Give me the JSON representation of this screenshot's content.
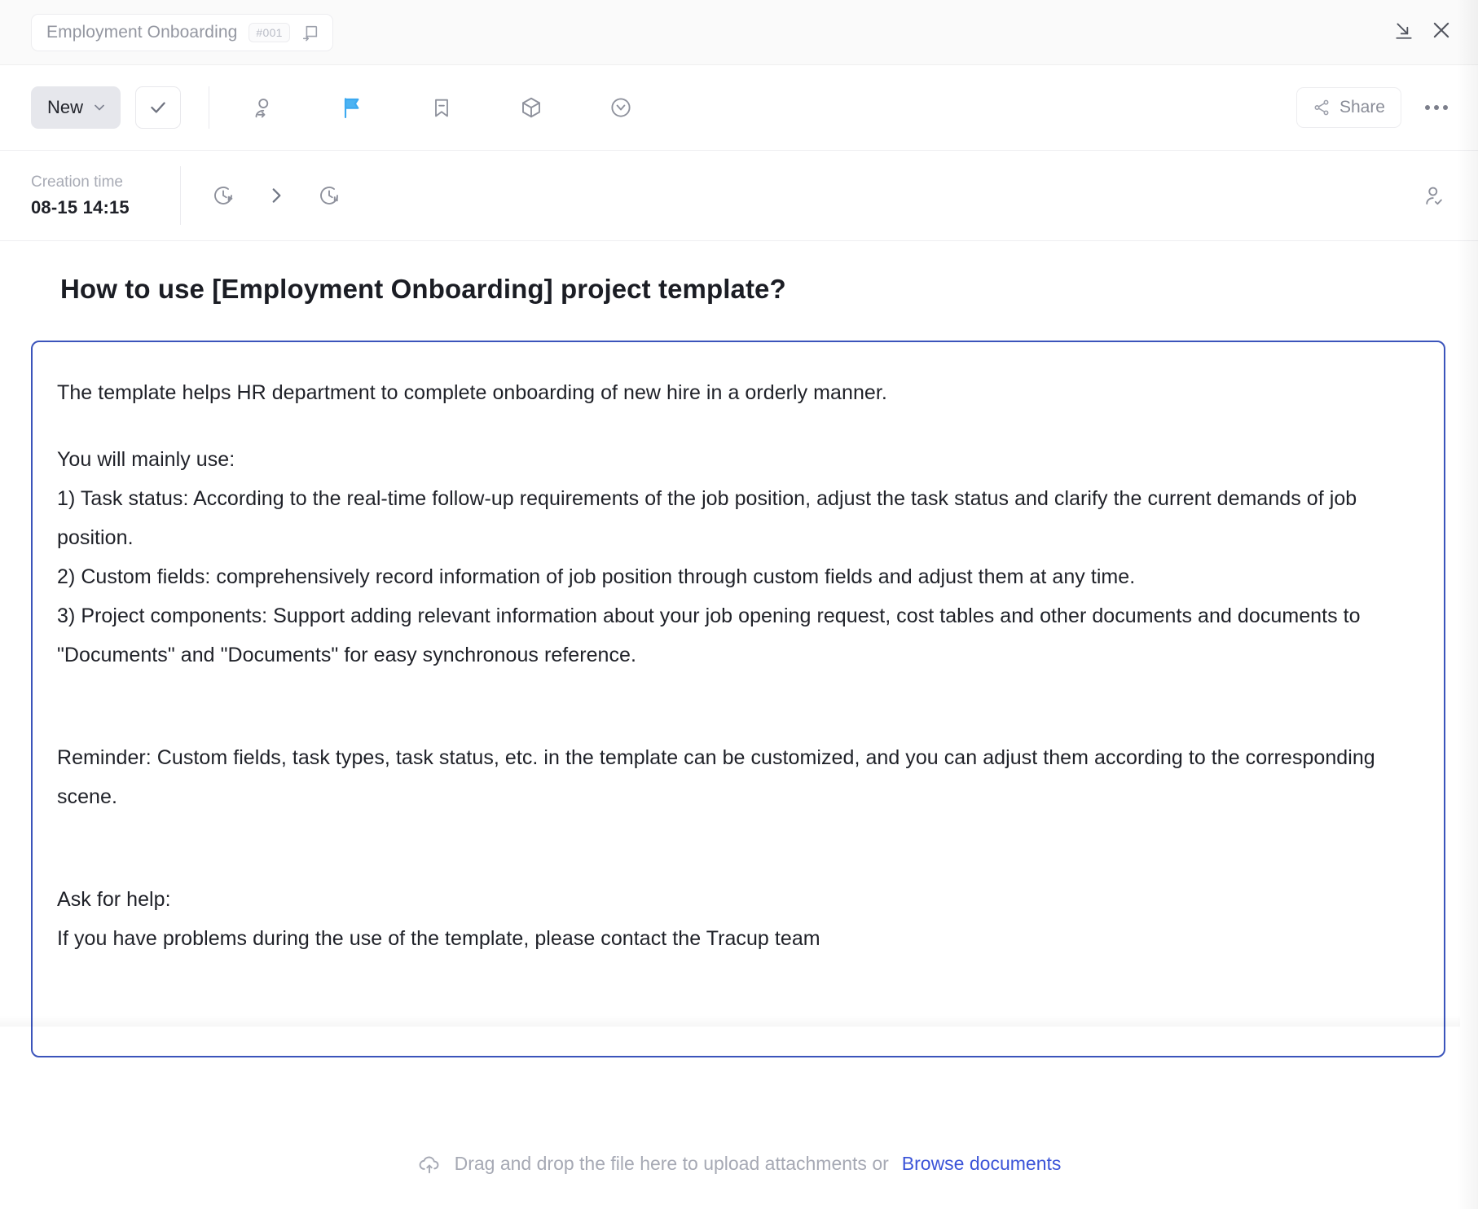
{
  "titlebar": {
    "breadcrumb_title": "Employment Onboarding",
    "task_id": "#001",
    "open_in_new_icon": "open-in-new-icon",
    "collapse_icon": "collapse-to-corner-icon",
    "close_icon": "close-icon"
  },
  "toolbar": {
    "status_label": "New",
    "status_caret_icon": "chevron-down-icon",
    "complete_icon": "check-icon",
    "items": [
      {
        "name": "assign-user",
        "icon": "user-add-icon"
      },
      {
        "name": "priority-flag",
        "icon": "flag-icon",
        "color": "#3ca9f0"
      },
      {
        "name": "bookmark",
        "icon": "bookmark-minus-icon"
      },
      {
        "name": "component",
        "icon": "cube-icon"
      },
      {
        "name": "version",
        "icon": "circle-chevron-down-icon"
      }
    ],
    "share_label": "Share",
    "share_icon": "share-icon",
    "more_icon": "more-horizontal-icon"
  },
  "meta": {
    "creation_time_label": "Creation time",
    "creation_time_value": "08-15 14:15",
    "start_time_icon": "clock-play-icon",
    "arrow_icon": "chevron-right-icon",
    "due_time_icon": "clock-pause-icon",
    "assignee_icon": "user-check-icon"
  },
  "document": {
    "title": "How to use [Employment Onboarding] project template?",
    "paragraphs": [
      "The template helps HR department to complete onboarding of new hire in a orderly manner.",
      "You will mainly use:",
      "1) Task status: According to the real-time follow-up requirements of the job position, adjust the task status and clarify the current demands of job position.",
      "2) Custom fields: comprehensively record  information of job position through custom fields and adjust them at any time.",
      "3) Project components: Support adding relevant information about your job opening request, cost tables and other documents and documents to \"Documents\" and \"Documents\" for easy synchronous reference.",
      "Reminder: Custom fields, task types, task status, etc. in the template can be customized, and you can adjust them according to the corresponding scene.",
      "Ask for help:",
      "If you have problems during the use of the template, please contact the Tracup team"
    ]
  },
  "footer": {
    "upload_icon": "cloud-upload-icon",
    "text": "Drag and drop the file here to upload attachments or",
    "link": "Browse documents"
  },
  "colors": {
    "accent_border": "#3b54bb",
    "link": "#3b54d8",
    "flag": "#3ca9f0",
    "status_bg": "#e6e7ec"
  }
}
